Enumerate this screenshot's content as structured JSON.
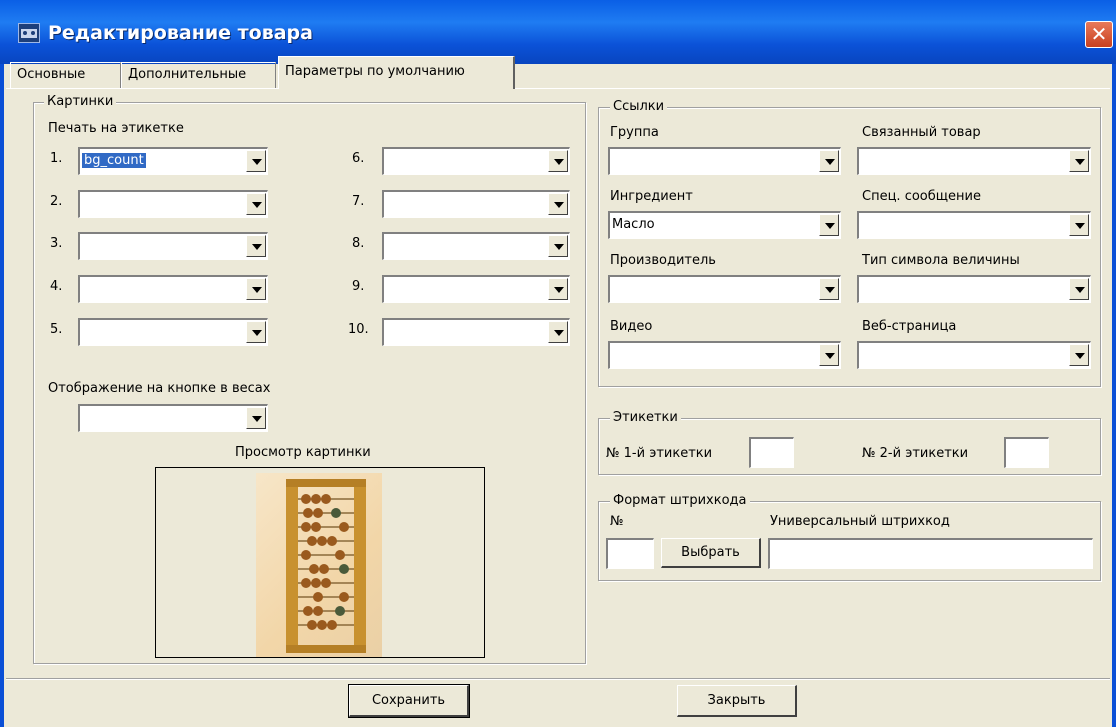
{
  "window": {
    "title": "Редактирование товара",
    "close_glyph": "✕"
  },
  "tabs": [
    "Основные",
    "Дополнительные",
    "Параметры по умолчанию"
  ],
  "pictures": {
    "legend": "Картинки",
    "print_label": "Печать на этикетке",
    "slots": [
      {
        "num": "1.",
        "value": "bg_count"
      },
      {
        "num": "2.",
        "value": ""
      },
      {
        "num": "3.",
        "value": ""
      },
      {
        "num": "4.",
        "value": ""
      },
      {
        "num": "5.",
        "value": ""
      },
      {
        "num": "6.",
        "value": ""
      },
      {
        "num": "7.",
        "value": ""
      },
      {
        "num": "8.",
        "value": ""
      },
      {
        "num": "9.",
        "value": ""
      },
      {
        "num": "10.",
        "value": ""
      }
    ],
    "button_display_label": "Отображение на кнопке в весах",
    "button_display_value": "",
    "preview_label": "Просмотр картинки",
    "preview_image": "abacus-image"
  },
  "links": {
    "legend": "Ссылки",
    "fields": [
      {
        "label": "Группа",
        "value": ""
      },
      {
        "label": "Связанный товар",
        "value": ""
      },
      {
        "label": "Ингредиент",
        "value": "Масло"
      },
      {
        "label": "Спец. сообщение",
        "value": ""
      },
      {
        "label": "Производитель",
        "value": ""
      },
      {
        "label": "Тип символа величины",
        "value": ""
      },
      {
        "label": "Видео",
        "value": ""
      },
      {
        "label": "Веб-страница",
        "value": ""
      }
    ]
  },
  "labels_group": {
    "legend": "Этикетки",
    "first_label": "№ 1-й этикетки",
    "first_value": "",
    "second_label": "№ 2-й этикетки",
    "second_value": ""
  },
  "barcode": {
    "legend": "Формат штрихкода",
    "num_label": "№",
    "num_value": "",
    "choose_button": "Выбрать",
    "universal_label": "Универсальный штрихкод",
    "universal_value": ""
  },
  "footer": {
    "save_button": "Сохранить",
    "close_button": "Закрыть"
  }
}
